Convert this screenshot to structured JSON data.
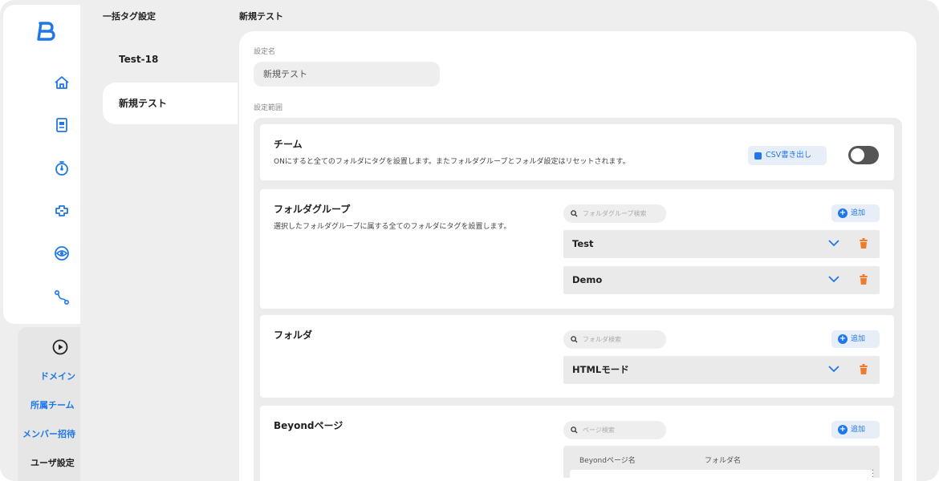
{
  "nav": {
    "bottom_links": [
      "ドメイン",
      "所属チーム",
      "メンバー招待",
      "ユーザ設定"
    ]
  },
  "tag_list": {
    "heading": "一括タグ設定",
    "items": [
      "Test-18",
      "新規テスト"
    ],
    "active_index": 1
  },
  "detail": {
    "heading": "新規テスト",
    "name_label": "設定名",
    "name_value": "新規テスト",
    "scope_label": "設定範囲",
    "team": {
      "title": "チーム",
      "description": "ONにすると全てのフォルダにタグを設置します。またフォルダグループとフォルダ設定はリセットされます。",
      "csv_label": "CSV書き出し",
      "toggle_on": false
    },
    "folder_group": {
      "title": "フォルダグループ",
      "description": "選択したフォルダグループに属する全てのフォルダにタグを設置します。",
      "search_placeholder": "フォルダグループ検索",
      "add_label": "追加",
      "rows": [
        "Test",
        "Demo"
      ]
    },
    "folder": {
      "title": "フォルダ",
      "search_placeholder": "フォルダ検索",
      "add_label": "追加",
      "rows": [
        "HTMLモード"
      ]
    },
    "beyond_page": {
      "title": "Beyondページ",
      "search_placeholder": "ページ検索",
      "add_label": "追加",
      "columns": [
        "Beyondページ名",
        "フォルダ名"
      ]
    }
  },
  "colors": {
    "accent": "#1f77e8",
    "danger": "#f07a2e",
    "toggle_off": "#555555"
  }
}
